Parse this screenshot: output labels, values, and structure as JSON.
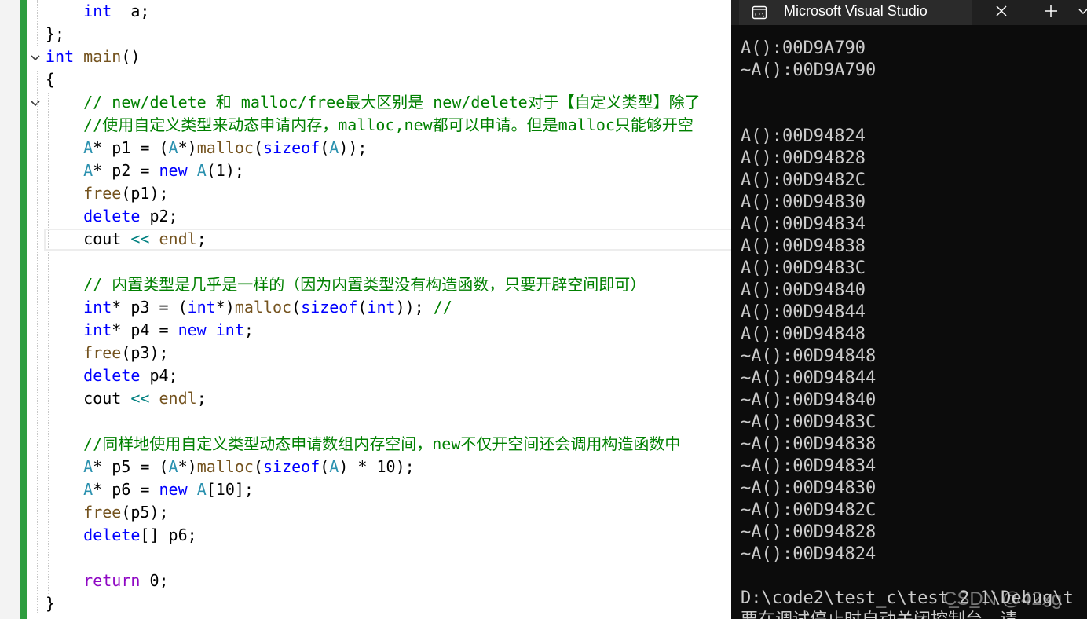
{
  "colors": {
    "keyword": "#0000ff",
    "type": "#2b91af",
    "function": "#74531f",
    "comment": "#008000",
    "plain": "#000000",
    "operator": "#008080",
    "control": "#8f08c4",
    "console_bg": "#0c0c0c",
    "console_text": "#cccccc",
    "change_bar": "#2e9d3f"
  },
  "editor": {
    "lines": [
      [
        {
          "t": "    ",
          "c": "plain"
        },
        {
          "t": "int",
          "c": "keyword"
        },
        {
          "t": " _a;",
          "c": "plain"
        }
      ],
      [
        {
          "t": "};",
          "c": "plain"
        }
      ],
      [
        {
          "t": "int",
          "c": "keyword"
        },
        {
          "t": " ",
          "c": "plain"
        },
        {
          "t": "main",
          "c": "function"
        },
        {
          "t": "()",
          "c": "plain"
        }
      ],
      [
        {
          "t": "{",
          "c": "plain"
        }
      ],
      [
        {
          "t": "    // new/delete 和 malloc/free最大区别是 new/delete对于【自定义类型】除了",
          "c": "comment"
        }
      ],
      [
        {
          "t": "    //使用自定义类型来动态申请内存，malloc,new都可以申请。但是malloc只能够开空",
          "c": "comment"
        }
      ],
      [
        {
          "t": "    ",
          "c": "plain"
        },
        {
          "t": "A",
          "c": "type"
        },
        {
          "t": "* p1 = (",
          "c": "plain"
        },
        {
          "t": "A",
          "c": "type"
        },
        {
          "t": "*)",
          "c": "plain"
        },
        {
          "t": "malloc",
          "c": "function"
        },
        {
          "t": "(",
          "c": "plain"
        },
        {
          "t": "sizeof",
          "c": "keyword"
        },
        {
          "t": "(",
          "c": "plain"
        },
        {
          "t": "A",
          "c": "type"
        },
        {
          "t": "));",
          "c": "plain"
        }
      ],
      [
        {
          "t": "    ",
          "c": "plain"
        },
        {
          "t": "A",
          "c": "type"
        },
        {
          "t": "* p2 = ",
          "c": "plain"
        },
        {
          "t": "new",
          "c": "keyword"
        },
        {
          "t": " ",
          "c": "plain"
        },
        {
          "t": "A",
          "c": "type"
        },
        {
          "t": "(1);",
          "c": "plain"
        }
      ],
      [
        {
          "t": "    ",
          "c": "plain"
        },
        {
          "t": "free",
          "c": "function"
        },
        {
          "t": "(p1);",
          "c": "plain"
        }
      ],
      [
        {
          "t": "    ",
          "c": "plain"
        },
        {
          "t": "delete",
          "c": "keyword"
        },
        {
          "t": " p2;",
          "c": "plain"
        }
      ],
      [
        {
          "t": "    cout ",
          "c": "plain"
        },
        {
          "t": "<<",
          "c": "operator"
        },
        {
          "t": " ",
          "c": "plain"
        },
        {
          "t": "endl",
          "c": "function"
        },
        {
          "t": ";",
          "c": "plain"
        }
      ],
      [],
      [
        {
          "t": "    // 内置类型是几乎是一样的（因为内置类型没有构造函数，只要开辟空间即可）",
          "c": "comment"
        }
      ],
      [
        {
          "t": "    ",
          "c": "plain"
        },
        {
          "t": "int",
          "c": "keyword"
        },
        {
          "t": "* p3 = (",
          "c": "plain"
        },
        {
          "t": "int",
          "c": "keyword"
        },
        {
          "t": "*)",
          "c": "plain"
        },
        {
          "t": "malloc",
          "c": "function"
        },
        {
          "t": "(",
          "c": "plain"
        },
        {
          "t": "sizeof",
          "c": "keyword"
        },
        {
          "t": "(",
          "c": "plain"
        },
        {
          "t": "int",
          "c": "keyword"
        },
        {
          "t": ")); ",
          "c": "plain"
        },
        {
          "t": "//",
          "c": "comment"
        }
      ],
      [
        {
          "t": "    ",
          "c": "plain"
        },
        {
          "t": "int",
          "c": "keyword"
        },
        {
          "t": "* p4 = ",
          "c": "plain"
        },
        {
          "t": "new",
          "c": "keyword"
        },
        {
          "t": " ",
          "c": "plain"
        },
        {
          "t": "int",
          "c": "keyword"
        },
        {
          "t": ";",
          "c": "plain"
        }
      ],
      [
        {
          "t": "    ",
          "c": "plain"
        },
        {
          "t": "free",
          "c": "function"
        },
        {
          "t": "(p3);",
          "c": "plain"
        }
      ],
      [
        {
          "t": "    ",
          "c": "plain"
        },
        {
          "t": "delete",
          "c": "keyword"
        },
        {
          "t": " p4;",
          "c": "plain"
        }
      ],
      [
        {
          "t": "    cout ",
          "c": "plain"
        },
        {
          "t": "<<",
          "c": "operator"
        },
        {
          "t": " ",
          "c": "plain"
        },
        {
          "t": "endl",
          "c": "function"
        },
        {
          "t": ";",
          "c": "plain"
        }
      ],
      [],
      [
        {
          "t": "    //同样地使用自定义类型动态申请数组内存空间，new不仅开空间还会调用构造函数中",
          "c": "comment"
        }
      ],
      [
        {
          "t": "    ",
          "c": "plain"
        },
        {
          "t": "A",
          "c": "type"
        },
        {
          "t": "* p5 = (",
          "c": "plain"
        },
        {
          "t": "A",
          "c": "type"
        },
        {
          "t": "*)",
          "c": "plain"
        },
        {
          "t": "malloc",
          "c": "function"
        },
        {
          "t": "(",
          "c": "plain"
        },
        {
          "t": "sizeof",
          "c": "keyword"
        },
        {
          "t": "(",
          "c": "plain"
        },
        {
          "t": "A",
          "c": "type"
        },
        {
          "t": ") * 10);",
          "c": "plain"
        }
      ],
      [
        {
          "t": "    ",
          "c": "plain"
        },
        {
          "t": "A",
          "c": "type"
        },
        {
          "t": "* p6 = ",
          "c": "plain"
        },
        {
          "t": "new",
          "c": "keyword"
        },
        {
          "t": " ",
          "c": "plain"
        },
        {
          "t": "A",
          "c": "type"
        },
        {
          "t": "[10];",
          "c": "plain"
        }
      ],
      [
        {
          "t": "    ",
          "c": "plain"
        },
        {
          "t": "free",
          "c": "function"
        },
        {
          "t": "(p5);",
          "c": "plain"
        }
      ],
      [
        {
          "t": "    ",
          "c": "plain"
        },
        {
          "t": "delete",
          "c": "keyword"
        },
        {
          "t": "[] p6;",
          "c": "plain"
        }
      ],
      [],
      [
        {
          "t": "    ",
          "c": "plain"
        },
        {
          "t": "return",
          "c": "control"
        },
        {
          "t": " 0;",
          "c": "plain"
        }
      ],
      [
        {
          "t": "}",
          "c": "plain"
        }
      ]
    ]
  },
  "console": {
    "title": "Microsoft Visual Studio 调试控",
    "icon": "console-app-icon",
    "lines": [
      "A():00D9A790",
      "~A():00D9A790",
      "",
      "",
      "A():00D94824",
      "A():00D94828",
      "A():00D9482C",
      "A():00D94830",
      "A():00D94834",
      "A():00D94838",
      "A():00D9483C",
      "A():00D94840",
      "A():00D94844",
      "A():00D94848",
      "~A():00D94848",
      "~A():00D94844",
      "~A():00D94840",
      "~A():00D9483C",
      "~A():00D94838",
      "~A():00D94834",
      "~A():00D94830",
      "~A():00D9482C",
      "~A():00D94828",
      "~A():00D94824",
      "",
      "D:\\code2\\test_c\\test_2_1\\Debug\\t",
      "要在调试停止时自动关闭控制台，请"
    ],
    "watermark": "CSDN @42xg"
  }
}
